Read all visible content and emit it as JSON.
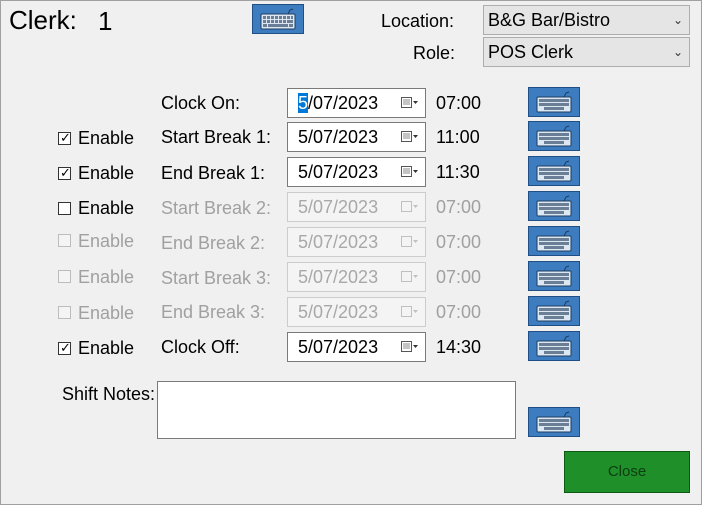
{
  "header": {
    "clerk_label": "Clerk:",
    "clerk_number": "1",
    "location_label": "Location:",
    "location_value": "B&G Bar/Bistro",
    "role_label": "Role:",
    "role_value": "POS Clerk"
  },
  "enable_label": "Enable",
  "rows": [
    {
      "label": "Clock On:",
      "date": "5/07/2023",
      "date_rest": "/07/2023",
      "date_sel": "5",
      "time": "07:00",
      "enabled": true,
      "has_check": false
    },
    {
      "label": "Start Break 1:",
      "date": "5/07/2023",
      "time": "11:00",
      "enabled": true,
      "checked": true
    },
    {
      "label": "End Break 1:",
      "date": "5/07/2023",
      "time": "11:30",
      "enabled": true,
      "checked": true
    },
    {
      "label": "Start Break 2:",
      "date": "5/07/2023",
      "time": "07:00",
      "enabled": false,
      "checked": false,
      "check_enabled": true
    },
    {
      "label": "End Break 2:",
      "date": "5/07/2023",
      "time": "07:00",
      "enabled": false,
      "checked": false,
      "check_enabled": false
    },
    {
      "label": "Start Break 3:",
      "date": "5/07/2023",
      "time": "07:00",
      "enabled": false,
      "checked": false,
      "check_enabled": false
    },
    {
      "label": "End Break 3:",
      "date": "5/07/2023",
      "time": "07:00",
      "enabled": false,
      "checked": false,
      "check_enabled": false
    },
    {
      "label": "Clock Off:",
      "date": "5/07/2023",
      "time": "14:30",
      "enabled": true,
      "checked": true
    }
  ],
  "notes": {
    "label": "Shift Notes:",
    "value": ""
  },
  "close_label": "Close",
  "colors": {
    "keyboard_button": "#3d7dbf",
    "close_button": "#1f8f29",
    "selection": "#0078d7"
  },
  "icons": {
    "keyboard": "keyboard-icon",
    "calendar": "calendar-dropdown-icon",
    "chevron": "chevron-down-icon",
    "check": "checkmark-icon"
  }
}
